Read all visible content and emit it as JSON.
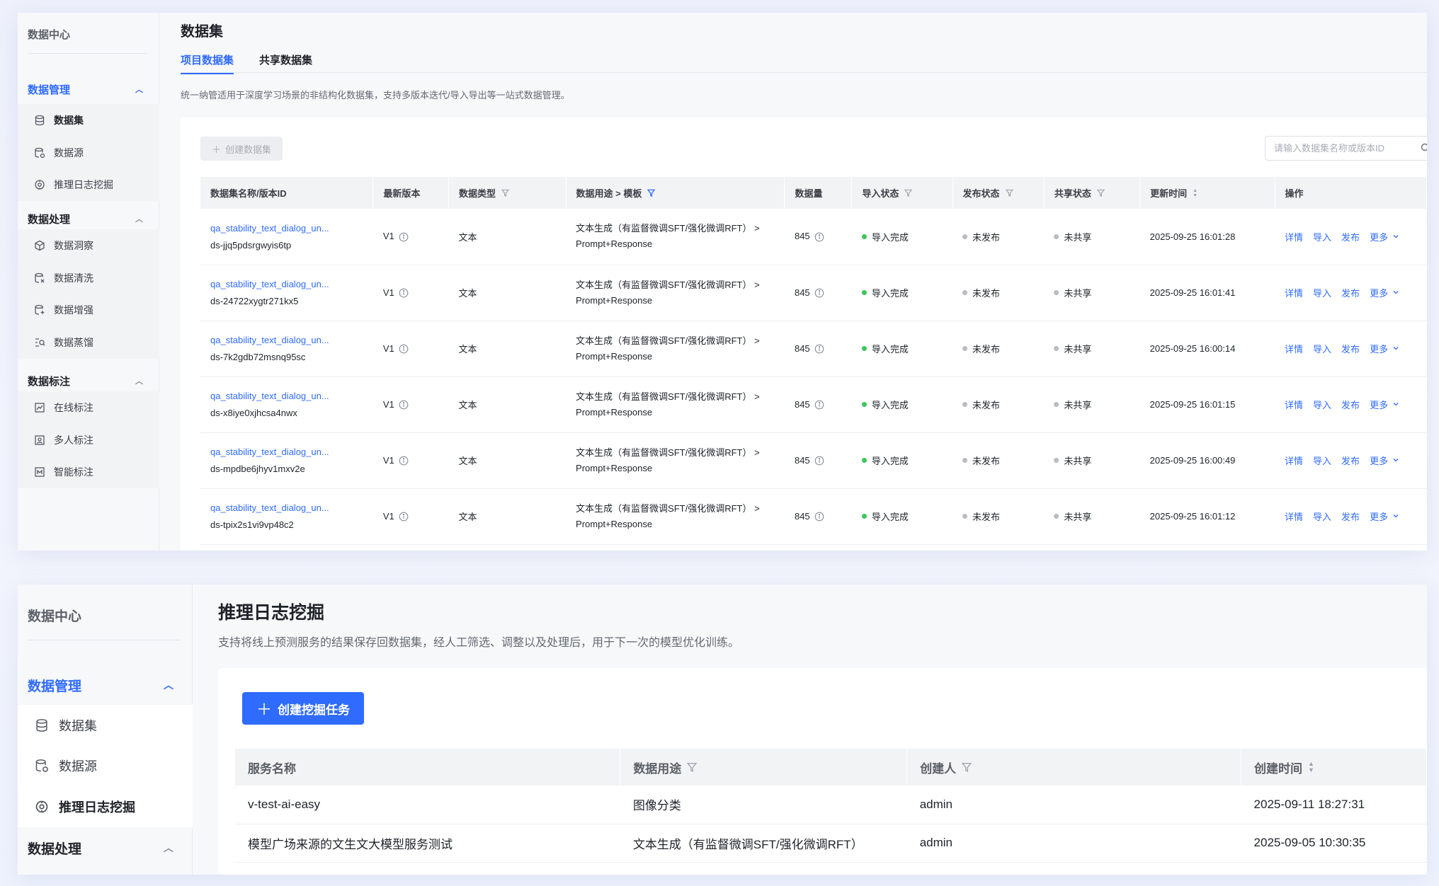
{
  "top": {
    "sidebar": {
      "title": "数据中心",
      "groups": [
        {
          "label": "数据管理",
          "active": true,
          "items": [
            {
              "label": "数据集",
              "icon": "database-icon",
              "current": true
            },
            {
              "label": "数据源",
              "icon": "datasource-icon"
            },
            {
              "label": "推理日志挖掘",
              "icon": "mining-icon"
            }
          ]
        },
        {
          "label": "数据处理",
          "items": [
            {
              "label": "数据洞察",
              "icon": "cube-icon"
            },
            {
              "label": "数据清洗",
              "icon": "clean-icon"
            },
            {
              "label": "数据增强",
              "icon": "enhance-icon"
            },
            {
              "label": "数据蒸馏",
              "icon": "distill-icon"
            }
          ]
        },
        {
          "label": "数据标注",
          "items": [
            {
              "label": "在线标注",
              "icon": "annotate-icon"
            },
            {
              "label": "多人标注",
              "icon": "multi-annotate-icon"
            },
            {
              "label": "智能标注",
              "icon": "smart-annotate-icon"
            }
          ]
        }
      ]
    },
    "page_title": "数据集",
    "tabs": [
      "项目数据集",
      "共享数据集"
    ],
    "description": "统一纳管适用于深度学习场景的非结构化数据集，支持多版本迭代/导入导出等一站式数据管理。",
    "create_button": "创建数据集",
    "search_placeholder": "请输入数据集名称或版本ID",
    "columns": [
      "数据集名称/版本ID",
      "最新版本",
      "数据类型",
      "数据用途 > 模板",
      "数据量",
      "导入状态",
      "发布状态",
      "共享状态",
      "更新时间",
      "操作"
    ],
    "rows": [
      {
        "name": "qa_stability_text_dialog_un...",
        "id": "ds-jjq5pdsrgwyis6tp",
        "version": "V1",
        "type": "文本",
        "usage_line1": "文本生成（有监督微调SFT/强化微调RFT） >",
        "usage_line2": "Prompt+Response",
        "count": "845",
        "import": "导入完成",
        "publish": "未发布",
        "share": "未共享",
        "updated": "2025-09-25 16:01:28"
      },
      {
        "name": "qa_stability_text_dialog_un...",
        "id": "ds-24722xygtr271kx5",
        "version": "V1",
        "type": "文本",
        "usage_line1": "文本生成（有监督微调SFT/强化微调RFT） >",
        "usage_line2": "Prompt+Response",
        "count": "845",
        "import": "导入完成",
        "publish": "未发布",
        "share": "未共享",
        "updated": "2025-09-25 16:01:41"
      },
      {
        "name": "qa_stability_text_dialog_un...",
        "id": "ds-7k2gdb72msnq95sc",
        "version": "V1",
        "type": "文本",
        "usage_line1": "文本生成（有监督微调SFT/强化微调RFT） >",
        "usage_line2": "Prompt+Response",
        "count": "845",
        "import": "导入完成",
        "publish": "未发布",
        "share": "未共享",
        "updated": "2025-09-25 16:00:14"
      },
      {
        "name": "qa_stability_text_dialog_un...",
        "id": "ds-x8iye0xjhcsa4nwx",
        "version": "V1",
        "type": "文本",
        "usage_line1": "文本生成（有监督微调SFT/强化微调RFT） >",
        "usage_line2": "Prompt+Response",
        "count": "845",
        "import": "导入完成",
        "publish": "未发布",
        "share": "未共享",
        "updated": "2025-09-25 16:01:15"
      },
      {
        "name": "qa_stability_text_dialog_un...",
        "id": "ds-mpdbe6jhyv1mxv2e",
        "version": "V1",
        "type": "文本",
        "usage_line1": "文本生成（有监督微调SFT/强化微调RFT） >",
        "usage_line2": "Prompt+Response",
        "count": "845",
        "import": "导入完成",
        "publish": "未发布",
        "share": "未共享",
        "updated": "2025-09-25 16:00:49"
      },
      {
        "name": "qa_stability_text_dialog_un...",
        "id": "ds-tpix2s1vi9vp48c2",
        "version": "V1",
        "type": "文本",
        "usage_line1": "文本生成（有监督微调SFT/强化微调RFT） >",
        "usage_line2": "Prompt+Response",
        "count": "845",
        "import": "导入完成",
        "publish": "未发布",
        "share": "未共享",
        "updated": "2025-09-25 16:01:12"
      }
    ],
    "ops": {
      "detail": "详情",
      "import": "导入",
      "publish": "发布",
      "more": "更多"
    }
  },
  "bottom": {
    "sidebar": {
      "title": "数据中心",
      "groups": [
        {
          "label": "数据管理",
          "active": true,
          "items": [
            {
              "label": "数据集",
              "icon": "database-icon"
            },
            {
              "label": "数据源",
              "icon": "datasource-icon"
            },
            {
              "label": "推理日志挖掘",
              "icon": "mining-icon",
              "current": true
            }
          ]
        },
        {
          "label": "数据处理",
          "items": []
        }
      ]
    },
    "page_title": "推理日志挖掘",
    "description": "支持将线上预测服务的结果保存回数据集，经人工筛选、调整以及处理后，用于下一次的模型优化训练。",
    "create_button": "创建挖掘任务",
    "columns": [
      "服务名称",
      "数据用途",
      "创建人",
      "创建时间"
    ],
    "rows": [
      {
        "service": "v-test-ai-easy",
        "usage": "图像分类",
        "creator": "admin",
        "created": "2025-09-11 18:27:31"
      },
      {
        "service": "模型广场来源的文生文大模型服务测试",
        "usage": "文本生成（有监督微调SFT/强化微调RFT）",
        "creator": "admin",
        "created": "2025-09-05 10:30:35"
      }
    ]
  },
  "colors": {
    "accent": "#2f6bff",
    "success": "#3ec55c",
    "muted": "#b8bcc3"
  }
}
